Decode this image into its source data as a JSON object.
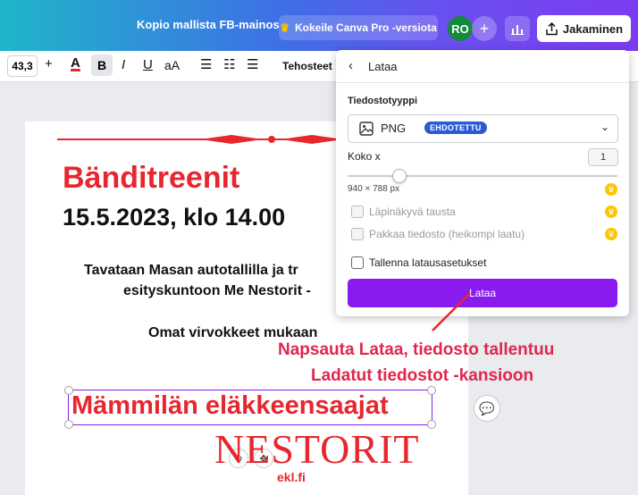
{
  "topbar": {
    "title": "Kopio mallista FB-mainos",
    "pro_label": "Kokeile Canva Pro -versiota",
    "avatar": "RO",
    "share_label": "Jakaminen"
  },
  "toolbar": {
    "font_size": "43,3",
    "effects_label": "Tehosteet"
  },
  "canvas": {
    "title": "Bänditreenit",
    "date": "15.5.2023, klo 14.00",
    "line1": "Tavataan Masan autotallilla ja tr",
    "line2": "esityskuntoon Me Nestorit -",
    "line3": "Omat virvokkeet mukaan",
    "org": "Mämmilän eläkkeensaajat",
    "logo": "NESTORIT",
    "logo_sub": "ekl.fi"
  },
  "panel": {
    "title": "Lataa",
    "file_type_label": "Tiedostotyyppi",
    "file_type_value": "PNG",
    "suggested_badge": "EHDOTETTU",
    "size_label": "Koko x",
    "size_value": "1",
    "dimensions": "940 × 788 px",
    "size_slider_fraction": 0.17,
    "transparent_label": "Läpinäkyvä tausta",
    "compress_label": "Pakkaa tiedosto (heikompi laatu)",
    "save_settings_label": "Tallenna latausasetukset",
    "download_button": "Lataa"
  },
  "annotation": {
    "line1": "Napsauta Lataa, tiedosto tallentuu",
    "line2": "Ladatut tiedostot -kansioon"
  },
  "colors": {
    "accent_purple": "#8a1bf0",
    "annotation_red": "#e8262e",
    "org_text": "#e8262e",
    "badge_blue": "#2b59d8",
    "crown": "#ffc400"
  }
}
